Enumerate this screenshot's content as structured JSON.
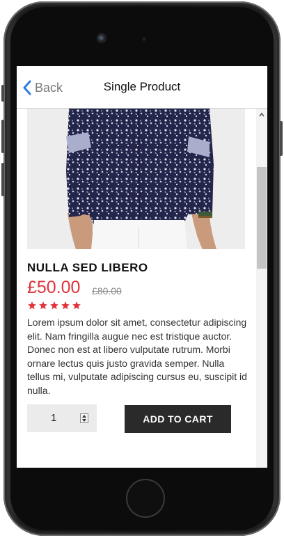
{
  "nav": {
    "back_label": "Back",
    "title": "Single Product"
  },
  "product": {
    "image_alt": "Man wearing navy floral print shirt",
    "name": "NULLA SED LIBERO",
    "price": "£50.00",
    "old_price": "£80.00",
    "rating": 5,
    "rating_max": 5,
    "description": "Lorem ipsum dolor sit amet, consectetur adipiscing elit. Nam fringilla augue nec est tristique auctor. Donec non est at libero vulputate rutrum. Morbi ornare lectus quis justo gravida semper. Nulla tellus mi, vulputate adipiscing cursus eu, suscipit id nulla."
  },
  "cart": {
    "quantity": "1",
    "add_label": "ADD TO CART"
  },
  "colors": {
    "accent_blue": "#2a7de1",
    "price_red": "#e0333c",
    "button_dark": "#2a2a2a"
  },
  "icons": {
    "back": "chevron-left-icon",
    "star": "star-icon",
    "scroll_up": "caret-up-icon"
  }
}
